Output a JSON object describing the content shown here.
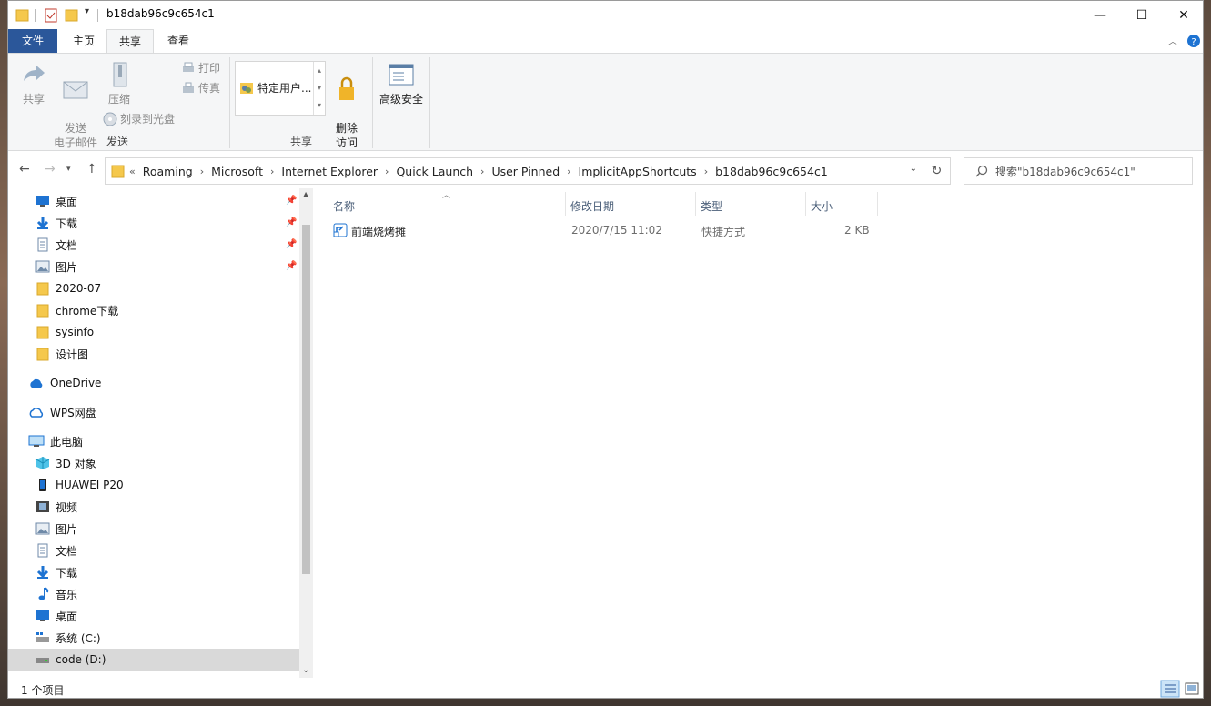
{
  "window": {
    "title": "b18dab96c9c654c1",
    "controls": {
      "minimize": "—",
      "maximize": "☐",
      "close": "✕"
    }
  },
  "tabs": {
    "file": "文件",
    "home": "主页",
    "share": "共享",
    "view": "查看"
  },
  "ribbon": {
    "share": "共享",
    "send_email": "发送\n电子邮件",
    "zip": "压缩",
    "print": "打印",
    "fax": "传真",
    "burn": "刻录到光盘",
    "specific_users": "特定用户...",
    "remove_access": "删除\n访问",
    "advanced_security": "高级安全",
    "group_send": "发送",
    "group_share": "共享"
  },
  "address": {
    "overflow": "«",
    "crumbs": [
      "Roaming",
      "Microsoft",
      "Internet Explorer",
      "Quick Launch",
      "User Pinned",
      "ImplicitAppShortcuts",
      "b18dab96c9c654c1"
    ],
    "search_placeholder": "搜索\"b18dab96c9c654c1\""
  },
  "nav": {
    "quick_access": [
      {
        "label": "桌面",
        "icon": "desktop-icon",
        "pinned": true
      },
      {
        "label": "下载",
        "icon": "download-icon",
        "pinned": true
      },
      {
        "label": "文档",
        "icon": "document-icon",
        "pinned": true
      },
      {
        "label": "图片",
        "icon": "picture-icon",
        "pinned": true
      },
      {
        "label": "2020-07",
        "icon": "folder-icon",
        "pinned": false
      },
      {
        "label": "chrome下载",
        "icon": "folder-icon",
        "pinned": false
      },
      {
        "label": "sysinfo",
        "icon": "folder-icon",
        "pinned": false
      },
      {
        "label": "设计图",
        "icon": "folder-icon",
        "pinned": false
      }
    ],
    "onedrive": "OneDrive",
    "wps": "WPS网盘",
    "this_pc": "此电脑",
    "pc_items": [
      {
        "label": "3D 对象",
        "icon": "3d-objects-icon"
      },
      {
        "label": "HUAWEI P20",
        "icon": "phone-icon"
      },
      {
        "label": "视频",
        "icon": "video-icon"
      },
      {
        "label": "图片",
        "icon": "picture-icon"
      },
      {
        "label": "文档",
        "icon": "document-icon"
      },
      {
        "label": "下载",
        "icon": "download-icon"
      },
      {
        "label": "音乐",
        "icon": "music-icon"
      },
      {
        "label": "桌面",
        "icon": "desktop-icon"
      },
      {
        "label": "系统 (C:)",
        "icon": "system-drive-icon"
      },
      {
        "label": "code (D:)",
        "icon": "drive-icon"
      }
    ]
  },
  "columns": {
    "name": "名称",
    "date": "修改日期",
    "type": "类型",
    "size": "大小"
  },
  "files": [
    {
      "name": "前端烧烤摊",
      "date": "2020/7/15 11:02",
      "type": "快捷方式",
      "size": "2 KB"
    }
  ],
  "status": {
    "count": "1 个项目"
  },
  "colors": {
    "file_tab": "#2b579a",
    "accent": "#0078d7",
    "folder": "#f5c84c"
  }
}
